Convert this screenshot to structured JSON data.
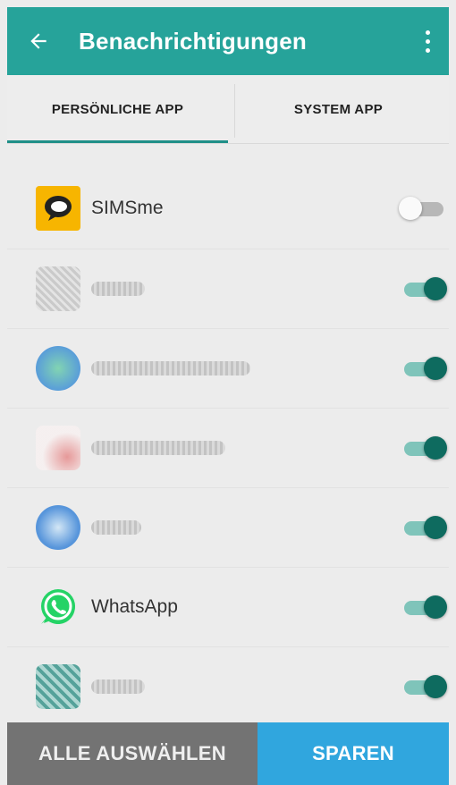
{
  "appbar": {
    "title": "Benachrichtigungen"
  },
  "tabs": [
    {
      "label": "PERSÖNLICHE APP",
      "active": true
    },
    {
      "label": "SYSTEM APP",
      "active": false
    }
  ],
  "apps": [
    {
      "name": "SIMSme",
      "enabled": false,
      "icon": "simsme-icon"
    },
    {
      "name": "",
      "enabled": true,
      "icon": "app-icon"
    },
    {
      "name": "",
      "enabled": true,
      "icon": "app-icon"
    },
    {
      "name": "",
      "enabled": true,
      "icon": "app-icon"
    },
    {
      "name": "",
      "enabled": true,
      "icon": "app-icon"
    },
    {
      "name": "WhatsApp",
      "enabled": true,
      "icon": "whatsapp-icon"
    },
    {
      "name": "",
      "enabled": true,
      "icon": "app-icon"
    }
  ],
  "footer": {
    "select_all_label": "ALLE AUSWÄHLEN",
    "save_label": "SPAREN"
  },
  "colors": {
    "appbar": "#26a39a",
    "toggle_on": "#0e6b5f",
    "save": "#30a6de",
    "select_all": "#737373"
  }
}
